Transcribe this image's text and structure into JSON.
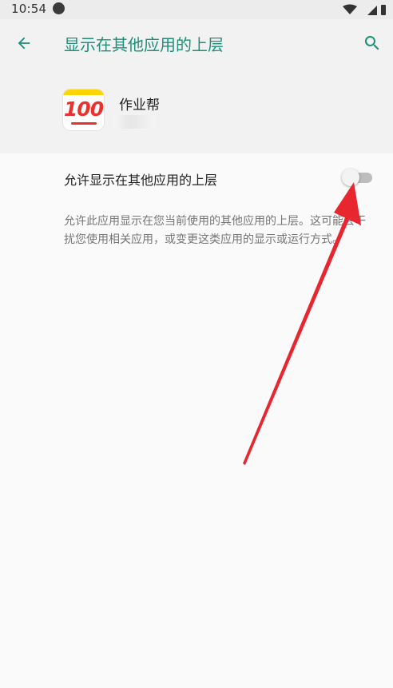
{
  "status_bar": {
    "time": "10:54"
  },
  "header": {
    "title": "显示在其他应用的上层",
    "back_icon": "arrow-back-icon",
    "search_icon": "search-icon"
  },
  "app": {
    "name": "作业帮",
    "icon_text": "100",
    "icon_colors": {
      "band": "#ffd400",
      "number": "#e8322e"
    }
  },
  "setting": {
    "label": "允许显示在其他应用的上层",
    "enabled": false,
    "description": "允许此应用显示在您当前使用的其他应用的上层。这可能会干扰您使用相关应用，或变更这类应用的显示或运行方式。"
  },
  "colors": {
    "accent": "#1e8f7a",
    "annotation_arrow": "#e8262f"
  }
}
